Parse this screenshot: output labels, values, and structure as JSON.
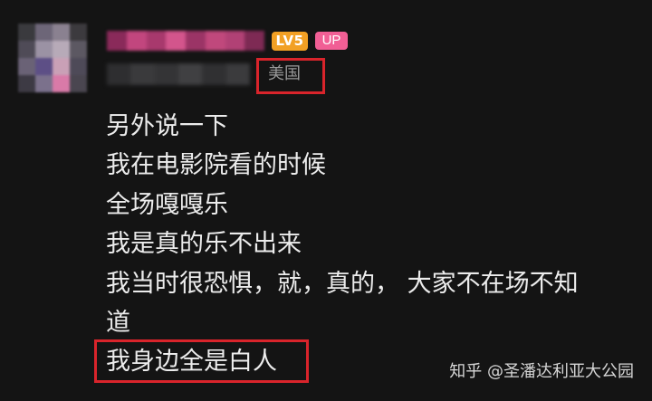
{
  "user": {
    "level_badge": "LV5",
    "up_badge": "UP",
    "location": "美国"
  },
  "comment": {
    "lines": [
      "另外说一下",
      "我在电影院看的时候",
      "全场嘎嘎乐",
      "我是真的乐不出来",
      "我当时很恐惧，就，真的， 大家不在场不知",
      "道",
      "我身边全是白人"
    ]
  },
  "watermark": "知乎 @圣潘达利亚大公园",
  "colors": {
    "background": "#141414",
    "highlight_border": "#d9242b",
    "level_badge": "#f2a024",
    "up_badge": "#f15f95"
  }
}
